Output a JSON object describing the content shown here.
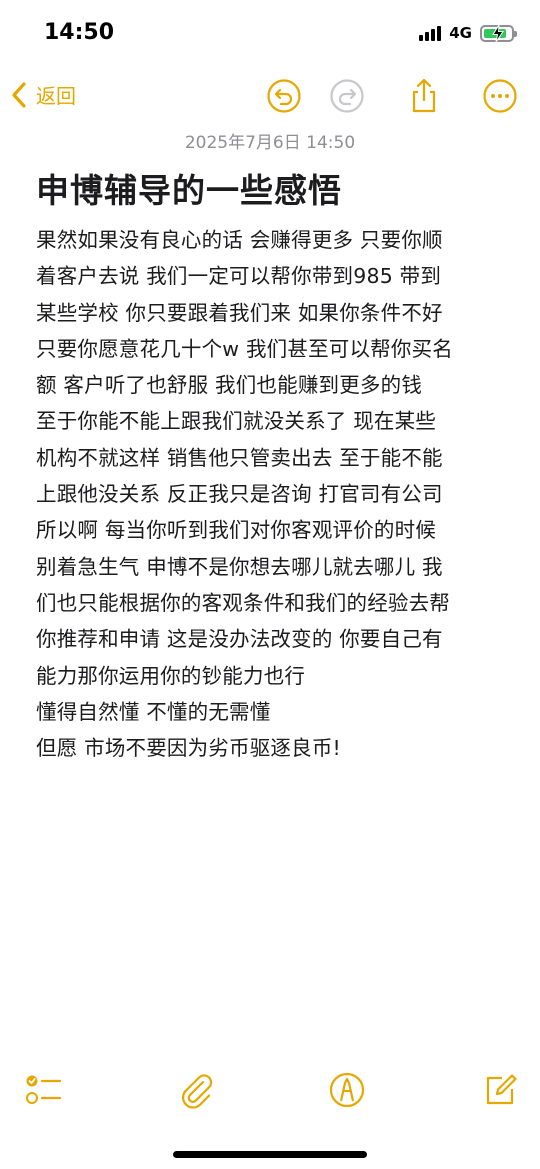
{
  "status_bar": {
    "time": "14:50",
    "network": "4G",
    "battery_level": 0.85
  },
  "nav": {
    "back_label": "返回"
  },
  "note": {
    "date": "2025年7月6日 14:50",
    "title": "申博辅导的一些感悟",
    "lines": [
      "果然如果没有良心的话 会赚得更多 只要你顺",
      "着客户去说 我们一定可以帮你带到985 带到",
      "某些学校 你只要跟着我们来 如果你条件不好",
      "只要你愿意花几十个w 我们甚至可以帮你买名",
      "额 客户听了也舒服 我们也能赚到更多的钱",
      "至于你能不能上跟我们就没关系了 现在某些",
      "机构不就这样 销售他只管卖出去 至于能不能",
      "上跟他没关系 反正我只是咨询 打官司有公司",
      "所以啊 每当你听到我们对你客观评价的时候",
      "别着急生气 申博不是你想去哪儿就去哪儿 我",
      "们也只能根据你的客观条件和我们的经验去帮",
      "你推荐和申请 这是没办法改变的 你要自己有",
      "能力那你运用你的钞能力也行",
      "懂得自然懂 不懂的无需懂",
      "但愿 市场不要因为劣币驱逐良币!"
    ]
  },
  "colors": {
    "accent": "#e6a700",
    "battery": "#34c759",
    "secondary": "#8e8e93"
  },
  "icons": {
    "back": "chevron-left-icon",
    "undo": "undo-icon",
    "redo": "redo-icon",
    "share": "share-icon",
    "more": "more-icon",
    "checklist": "checklist-icon",
    "attach": "paperclip-icon",
    "markup": "markup-pen-icon",
    "compose": "compose-icon"
  }
}
